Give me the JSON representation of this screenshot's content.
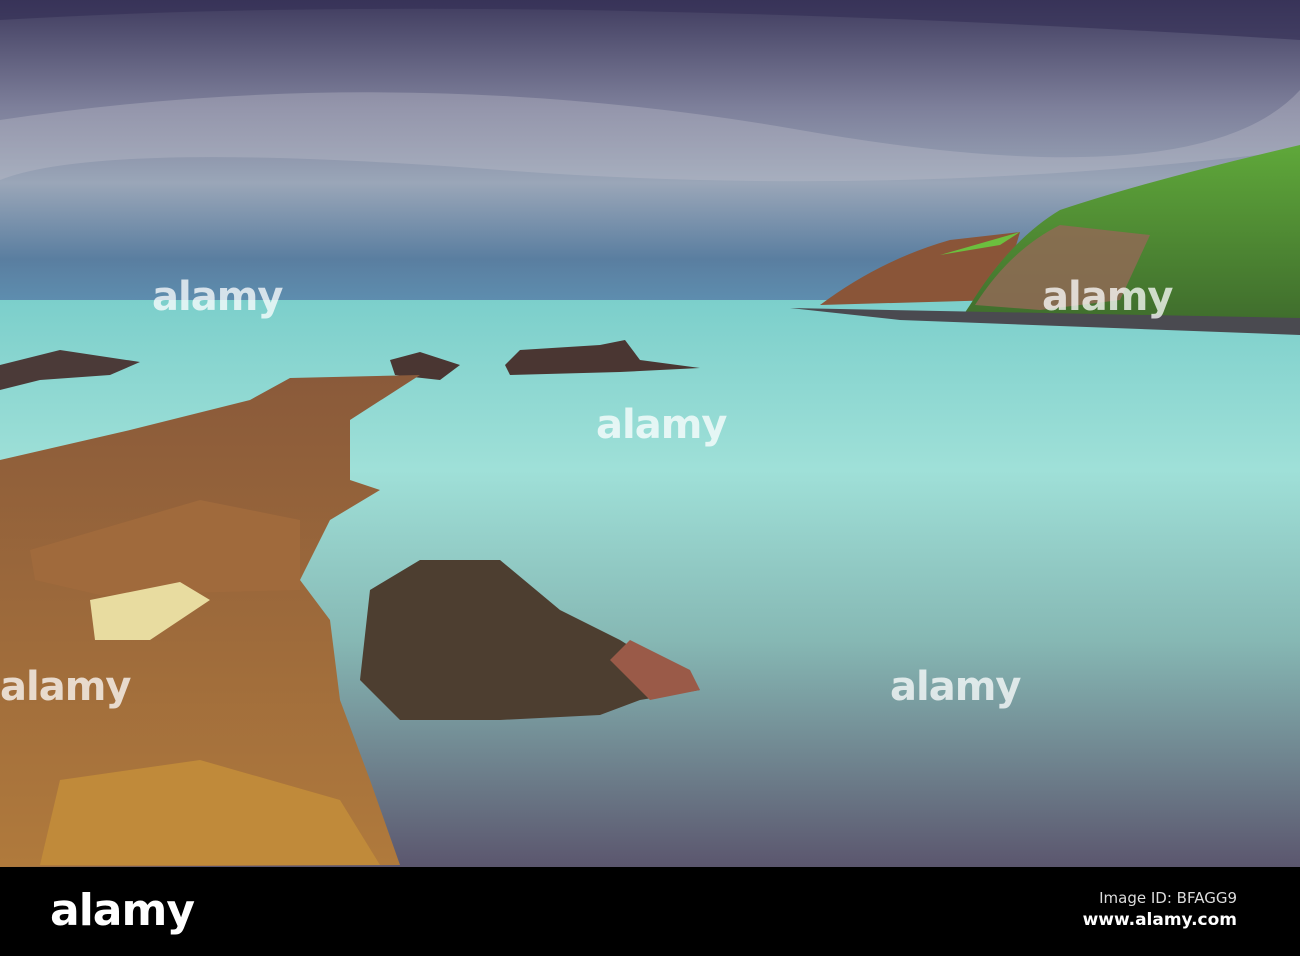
{
  "photo": {
    "subject": "Rocky shoreline with long-exposure sea and green headland cliffs"
  },
  "watermark": {
    "text": "alamy"
  },
  "footer": {
    "logo": "alamy",
    "image_id": "Image ID: BFAGG9",
    "website": "www.alamy.com"
  }
}
